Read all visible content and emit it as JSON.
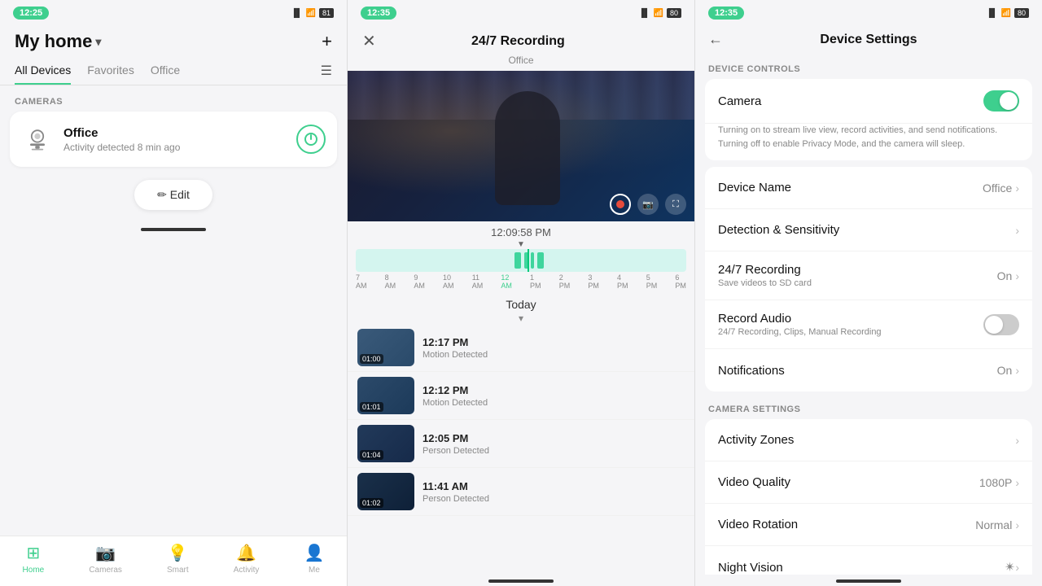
{
  "screen1": {
    "status_time": "12:25",
    "battery": "81",
    "title": "My home",
    "plus_label": "+",
    "tabs": [
      {
        "label": "All Devices",
        "active": true
      },
      {
        "label": "Favorites",
        "active": false
      },
      {
        "label": "Office",
        "active": false
      }
    ],
    "section_cameras": "CAMERAS",
    "camera": {
      "name": "Office",
      "status": "Activity detected 8 min ago"
    },
    "edit_btn": "✏ Edit",
    "nav": [
      {
        "icon": "🏠",
        "label": "Home",
        "active": true
      },
      {
        "icon": "📷",
        "label": "Cameras",
        "active": false
      },
      {
        "icon": "💡",
        "label": "Smart",
        "active": false
      },
      {
        "icon": "🔔",
        "label": "Activity",
        "active": false
      },
      {
        "icon": "👤",
        "label": "Me",
        "active": false
      }
    ]
  },
  "screen2": {
    "status_time": "12:35",
    "battery": "80",
    "title": "24/7 Recording",
    "subtitle": "Office",
    "timestamp": "12:09:58 PM",
    "today_label": "Today",
    "timeline_labels": [
      "7\nAM",
      "8\nAM",
      "9\nAM",
      "10\nAM",
      "11\nAM",
      "12\nAM",
      "1\nPM",
      "2\nPM",
      "3\nPM",
      "4\nPM",
      "5\nPM",
      "6\nPM"
    ],
    "clips": [
      {
        "time": "12:17 PM",
        "event": "Motion Detected",
        "duration": "01:00",
        "color": "#3a5a7a"
      },
      {
        "time": "12:12 PM",
        "event": "Motion Detected",
        "duration": "01:01",
        "color": "#2c4a6a"
      },
      {
        "time": "12:05 PM",
        "event": "Person Detected",
        "duration": "01:04",
        "color": "#223a5a"
      },
      {
        "time": "11:41 AM",
        "event": "Person Detected",
        "duration": "01:02",
        "color": "#1a304a"
      }
    ]
  },
  "screen3": {
    "status_time": "12:35",
    "battery": "80",
    "title": "Device Settings",
    "section_device_controls": "DEVICE CONTROLS",
    "section_camera_settings": "CAMERA SETTINGS",
    "camera_toggle": true,
    "camera_label": "Camera",
    "camera_desc": "Turning on to stream live view, record activities, and send notifications. Turning off to enable Privacy Mode, and the camera will sleep.",
    "device_name_label": "Device Name",
    "device_name_value": "Office",
    "detection_label": "Detection & Sensitivity",
    "recording_label": "24/7 Recording",
    "recording_sub": "Save videos to SD card",
    "recording_value": "On",
    "audio_label": "Record Audio",
    "audio_sub": "24/7 Recording, Clips, Manual Recording",
    "audio_toggle": false,
    "notifications_label": "Notifications",
    "notifications_value": "On",
    "activity_zones_label": "Activity Zones",
    "video_quality_label": "Video Quality",
    "video_quality_value": "1080P",
    "video_rotation_label": "Video Rotation",
    "video_rotation_value": "Normal",
    "night_vision_label": "Night Vision"
  }
}
